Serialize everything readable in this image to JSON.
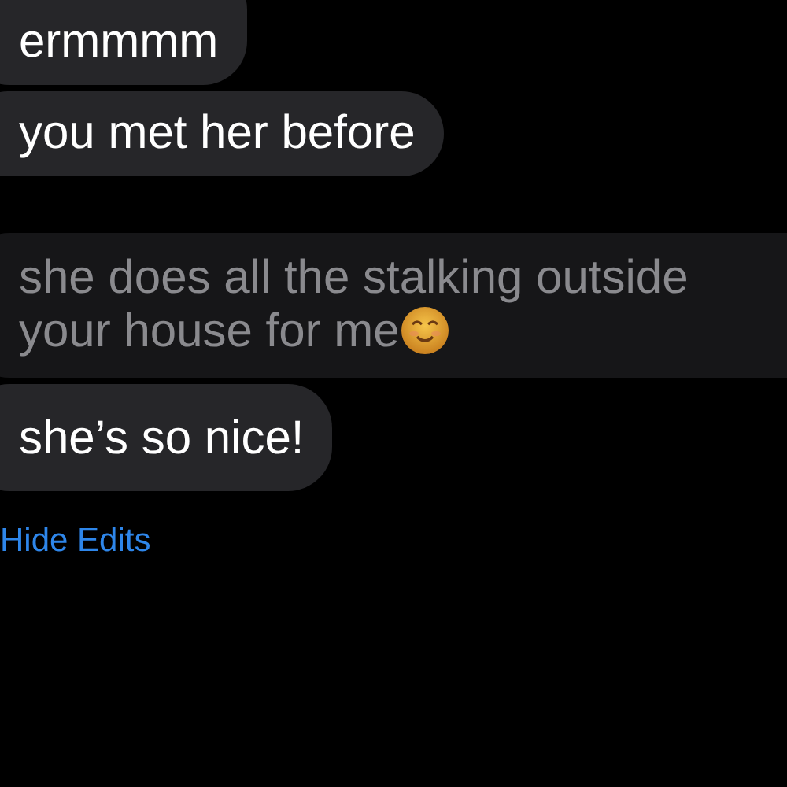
{
  "messages": [
    {
      "kind": "message",
      "text": "ermmmm"
    },
    {
      "kind": "message",
      "text": "you met her before"
    },
    {
      "kind": "previous_edit",
      "text": "she does all the stalking outside your house for me"
    },
    {
      "kind": "message",
      "text": "she’s so nice!"
    }
  ],
  "edit_toggle": {
    "label": "Hide Edits"
  }
}
